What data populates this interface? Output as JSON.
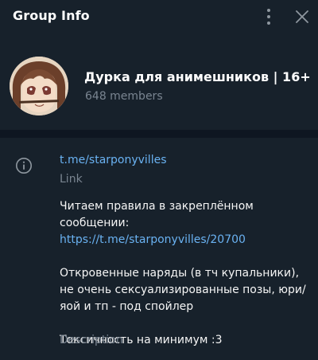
{
  "header": {
    "title": "Group Info",
    "menu_icon": "vertical-dots-icon",
    "close_icon": "close-icon"
  },
  "group": {
    "name": "Дурка для анимешников | 16+",
    "members": "648 members"
  },
  "info": {
    "icon": "info-icon",
    "link": "t.me/starponyvilles",
    "link_label": "Link",
    "description": {
      "line1_text": "Читаем правила в закреплённом сообщении: ",
      "line1_link": "https://t.me/starponyvilles/20700",
      "line2": "Откровенные наряды (в тч купальники),  не очень сексуализированные позы, юри/яой и тп - под спойлер",
      "line3": "Токсичность на минимум :3"
    },
    "description_label": "Description"
  },
  "colors": {
    "background": "#17212b",
    "divider": "#0e1621",
    "link": "#6ab2f2",
    "secondary_text": "#7a8591"
  }
}
